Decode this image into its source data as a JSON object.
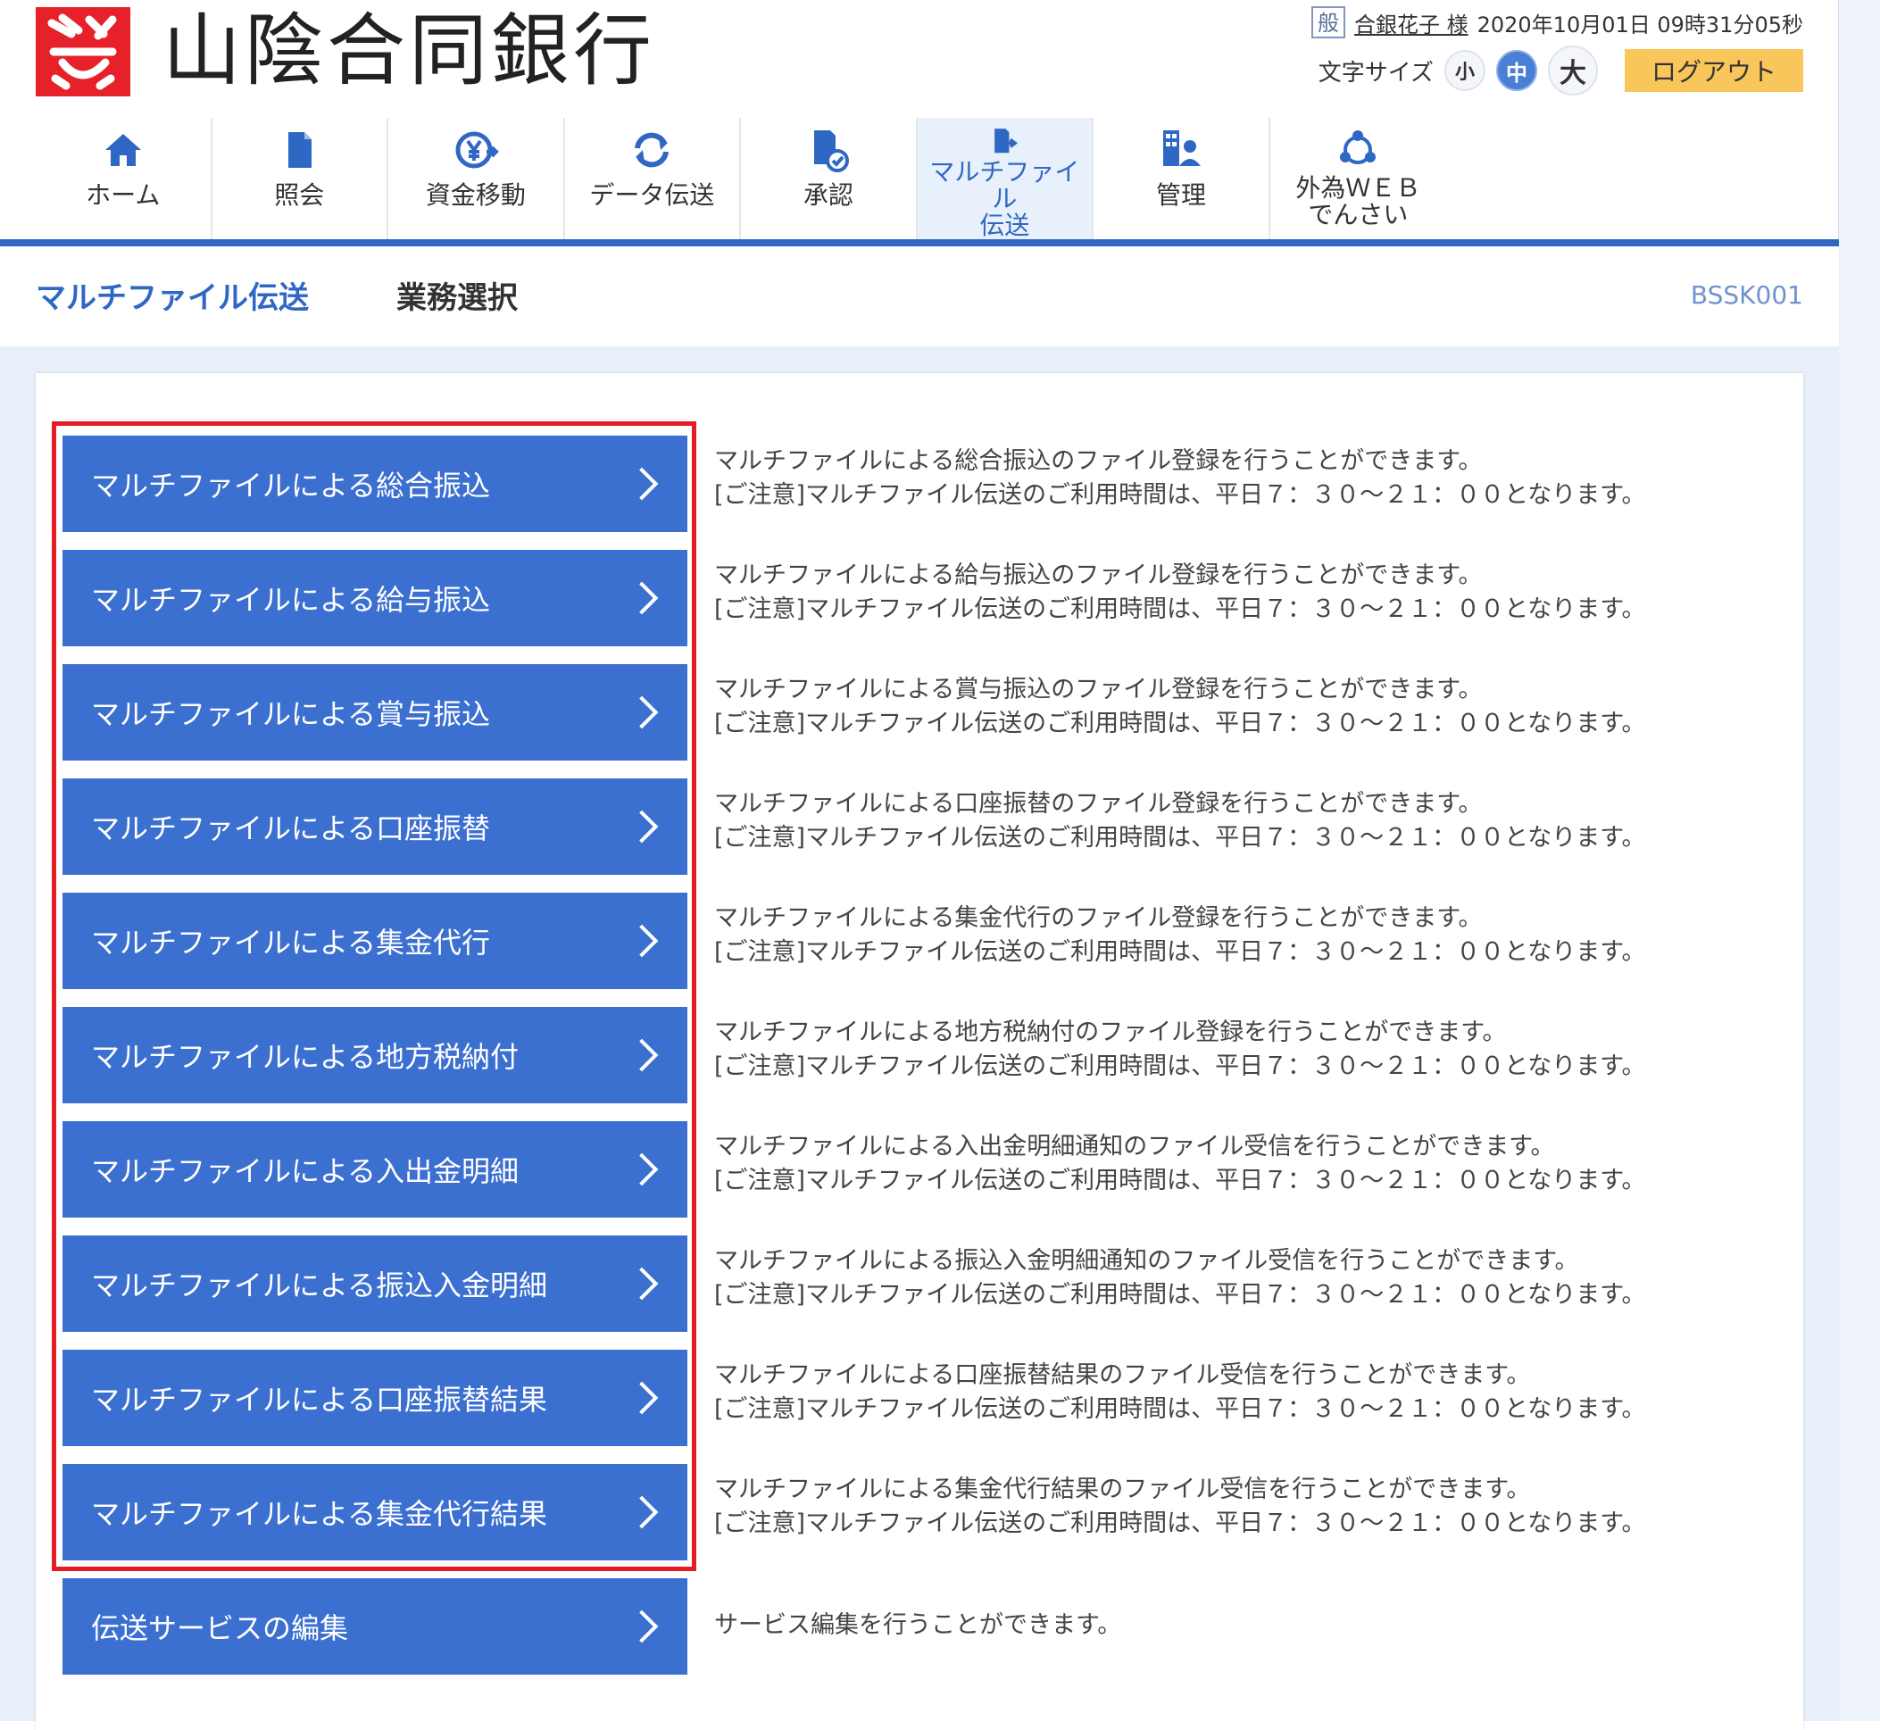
{
  "header": {
    "bank_name": "山陰合同銀行",
    "user_badge": "般",
    "user_name": "合銀花子 様",
    "datetime": "2020年10月01日 09時31分05秒",
    "font_size_label": "文字サイズ",
    "font_small": "小",
    "font_medium": "中",
    "font_large": "大",
    "logout_label": "ログアウト"
  },
  "nav": {
    "items": [
      {
        "label": "ホーム",
        "icon": "home-icon"
      },
      {
        "label": "照会",
        "icon": "document-icon"
      },
      {
        "label": "資金移動",
        "icon": "yen-transfer-icon"
      },
      {
        "label": "データ伝送",
        "icon": "sync-icon"
      },
      {
        "label": "承認",
        "icon": "approve-document-icon"
      },
      {
        "label_line1": "マルチファイル",
        "label_line2": "伝送",
        "icon": "file-transfer-icon",
        "active": true
      },
      {
        "label": "管理",
        "icon": "admin-icon"
      },
      {
        "label_line1": "外為ＷＥＢ",
        "label_line2": "でんさい",
        "icon": "network-icon"
      }
    ]
  },
  "page": {
    "title": "マルチファイル伝送",
    "subtitle": "業務選択",
    "screen_id": "BSSK001"
  },
  "menu": [
    {
      "label": "マルチファイルによる総合振込",
      "desc1": "マルチファイルによる総合振込のファイル登録を行うことができます。",
      "desc2": "[ご注意]マルチファイル伝送のご利用時間は、平日７：３０～２１：００となります。"
    },
    {
      "label": "マルチファイルによる給与振込",
      "desc1": "マルチファイルによる給与振込のファイル登録を行うことができます。",
      "desc2": "[ご注意]マルチファイル伝送のご利用時間は、平日７：３０～２１：００となります。"
    },
    {
      "label": "マルチファイルによる賞与振込",
      "desc1": "マルチファイルによる賞与振込のファイル登録を行うことができます。",
      "desc2": "[ご注意]マルチファイル伝送のご利用時間は、平日７：３０～２１：００となります。"
    },
    {
      "label": "マルチファイルによる口座振替",
      "desc1": "マルチファイルによる口座振替のファイル登録を行うことができます。",
      "desc2": "[ご注意]マルチファイル伝送のご利用時間は、平日７：３０～２１：００となります。"
    },
    {
      "label": "マルチファイルによる集金代行",
      "desc1": "マルチファイルによる集金代行のファイル登録を行うことができます。",
      "desc2": "[ご注意]マルチファイル伝送のご利用時間は、平日７：３０～２１：００となります。"
    },
    {
      "label": "マルチファイルによる地方税納付",
      "desc1": "マルチファイルによる地方税納付のファイル登録を行うことができます。",
      "desc2": "[ご注意]マルチファイル伝送のご利用時間は、平日７：３０～２１：００となります。"
    },
    {
      "label": "マルチファイルによる入出金明細",
      "desc1": "マルチファイルによる入出金明細通知のファイル受信を行うことができます。",
      "desc2": "[ご注意]マルチファイル伝送のご利用時間は、平日７：３０～２１：００となります。"
    },
    {
      "label": "マルチファイルによる振込入金明細",
      "desc1": "マルチファイルによる振込入金明細通知のファイル受信を行うことができます。",
      "desc2": "[ご注意]マルチファイル伝送のご利用時間は、平日７：３０～２１：００となります。"
    },
    {
      "label": "マルチファイルによる口座振替結果",
      "desc1": "マルチファイルによる口座振替結果のファイル受信を行うことができます。",
      "desc2": "[ご注意]マルチファイル伝送のご利用時間は、平日７：３０～２１：００となります。"
    },
    {
      "label": "マルチファイルによる集金代行結果",
      "desc1": "マルチファイルによる集金代行結果のファイル受信を行うことができます。",
      "desc2": "[ご注意]マルチファイル伝送のご利用時間は、平日７：３０～２１：００となります。"
    },
    {
      "label": "伝送サービスの編集",
      "desc1": "サービス編集を行うことができます。"
    }
  ],
  "colors": {
    "accent_blue": "#2f67c4",
    "button_blue": "#3b6fd0",
    "logo_red": "#e6212a",
    "highlight_red": "#e51c23",
    "logout_yellow": "#f8c65a"
  }
}
